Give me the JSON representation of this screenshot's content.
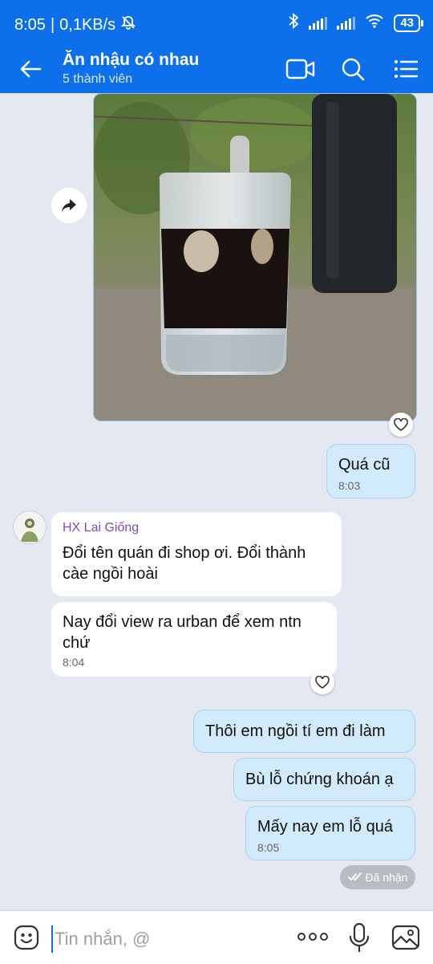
{
  "status_bar": {
    "time": "8:05",
    "net_speed": "0,1KB/s",
    "battery": "43"
  },
  "header": {
    "title": "Ăn nhậu có nhau",
    "subtitle": "5 thành viên"
  },
  "messages": [
    {
      "id": "m1",
      "side": "me",
      "text": "Quá cũ",
      "time": "8:03"
    },
    {
      "id": "m2",
      "side": "them",
      "sender": "HX Lai Giống",
      "text_line1": "Đổi tên quán đi shop ơi. Đổi thành",
      "text_line2": "càe ngồi hoài"
    },
    {
      "id": "m3",
      "side": "them",
      "text_line1": "Nay đổi view ra urban để xem ntn",
      "text_line2": "chứ",
      "time": "8:04"
    },
    {
      "id": "m4",
      "side": "me",
      "text": "Thôi em ngồi tí em đi làm"
    },
    {
      "id": "m5",
      "side": "me",
      "text": "Bù lỗ chứng khoán ạ"
    },
    {
      "id": "m6",
      "side": "me",
      "text": "Mấy nay em lỗ quá",
      "time": "8:05"
    }
  ],
  "status_received": "Đã nhận",
  "composer": {
    "placeholder": "Tin nhắn, @"
  },
  "colors": {
    "brand": "#0d6fea",
    "my_bubble": "#d2ebfc",
    "sender_name": "#7a4bb6",
    "background": "#e4e8f0"
  }
}
